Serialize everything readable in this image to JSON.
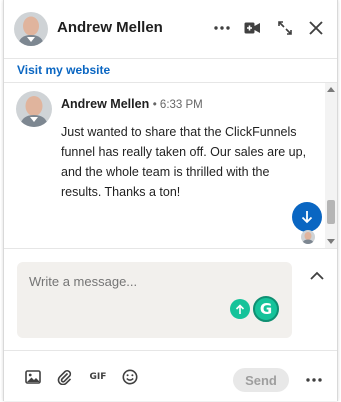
{
  "header": {
    "contact_name": "Andrew Mellen",
    "icons": [
      "more-options-icon",
      "video-call-icon",
      "expand-icon",
      "close-icon"
    ]
  },
  "profile_link": "Visit my website",
  "message": {
    "author": "Andrew Mellen",
    "time": "• 6:33 PM",
    "body": "Just wanted to share that the ClickFunnels funnel has really taken off. Our sales are up, and the whole team is thrilled with the results. Thanks a ton!"
  },
  "compose": {
    "placeholder": "Write a message..."
  },
  "toolbar": {
    "gif_label": "GIF",
    "send_label": "Send",
    "icons": [
      "image-icon",
      "attachment-icon",
      "gif-icon",
      "emoji-icon",
      "more-options-icon"
    ]
  },
  "colors": {
    "accent": "#0a66c2",
    "grammarly": "#15c39a",
    "compose_bg": "#f2f0ed"
  }
}
